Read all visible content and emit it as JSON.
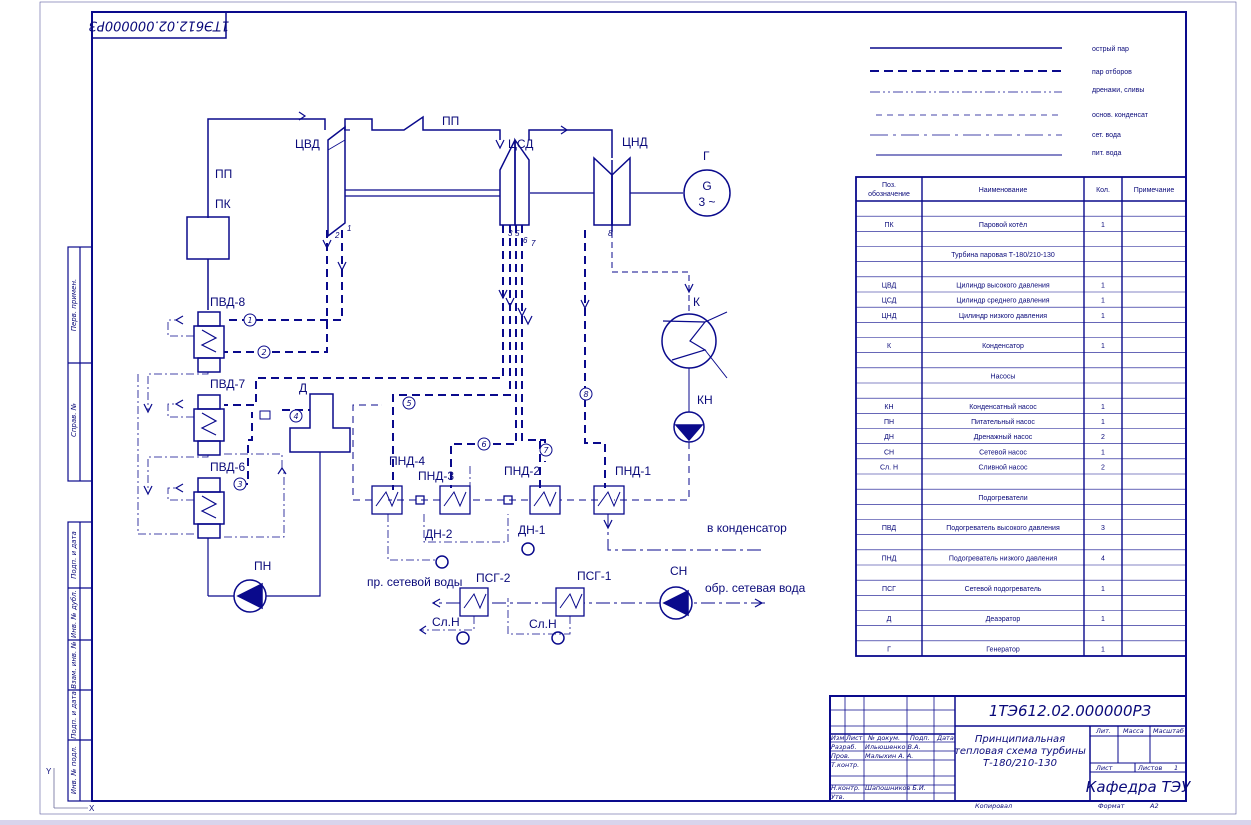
{
  "doc_code_rotated": "1ТЭ612.02.000000РЗ",
  "legend": [
    {
      "text": "острый пар"
    },
    {
      "text": "пар отборов"
    },
    {
      "text": "дренажи, сливы"
    },
    {
      "text": "основ. конденсат"
    },
    {
      "text": "сет. вода"
    },
    {
      "text": "пит. вода"
    }
  ],
  "equipment": {
    "pp1": "ПП",
    "pp2": "ПП",
    "pk": "ПК",
    "cvd": "ЦВД",
    "csd": "ЦСД",
    "cnd": "ЦНД",
    "g": "Г",
    "gen_g": "G",
    "gen_phase": "3 ~",
    "k": "К",
    "kn": "КН",
    "pvd8": "ПВД-8",
    "pvd7": "ПВД-7",
    "pvd6": "ПВД-6",
    "d": "Д",
    "pn": "ПН",
    "pnd4": "ПНД-4",
    "pnd3": "ПНД-3",
    "pnd2": "ПНД-2",
    "pnd1": "ПНД-1",
    "dn2": "ДН-2",
    "dn1": "ДН-1",
    "psg2": "ПСГ-2",
    "psg1": "ПСГ-1",
    "sln_a": "Сл.Н",
    "sln_b": "Сл.Н",
    "sn": "СН",
    "to_condenser": "в конденсатор",
    "pr_water": "пр. сетевой воды",
    "obr_water": "обр. сетевая вода"
  },
  "extraction_numbers": [
    "1",
    "2",
    "3",
    "4",
    "5",
    "6",
    "7",
    "8"
  ],
  "spec_table": {
    "headers": [
      "Поз. обозначение",
      "Наименование",
      "Кол.",
      "Примечание"
    ],
    "rows": [
      [
        "",
        "",
        "",
        ""
      ],
      [
        "ПК",
        "Паровой котёл",
        "1",
        ""
      ],
      [
        "",
        "",
        "",
        ""
      ],
      [
        "",
        "Турбина паровая Т-180/210-130",
        "",
        ""
      ],
      [
        "",
        "",
        "",
        ""
      ],
      [
        "ЦВД",
        "Цилиндр высокого давления",
        "1",
        ""
      ],
      [
        "ЦСД",
        "Цилиндр среднего давления",
        "1",
        ""
      ],
      [
        "ЦНД",
        "Цилиндр низкого давления",
        "1",
        ""
      ],
      [
        "",
        "",
        "",
        ""
      ],
      [
        "К",
        "Конденсатор",
        "1",
        ""
      ],
      [
        "",
        "",
        "",
        ""
      ],
      [
        "",
        "Насосы",
        "",
        ""
      ],
      [
        "",
        "",
        "",
        ""
      ],
      [
        "КН",
        "Конденсатный насос",
        "1",
        ""
      ],
      [
        "ПН",
        "Питательный насос",
        "1",
        ""
      ],
      [
        "ДН",
        "Дренажный насос",
        "2",
        ""
      ],
      [
        "СН",
        "Сетевой насос",
        "1",
        ""
      ],
      [
        "Сл. Н",
        "Сливной насос",
        "2",
        ""
      ],
      [
        "",
        "",
        "",
        ""
      ],
      [
        "",
        "Подогреватели",
        "",
        ""
      ],
      [
        "",
        "",
        "",
        ""
      ],
      [
        "ПВД",
        "Подогреватель высокого давления",
        "3",
        ""
      ],
      [
        "",
        "",
        "",
        ""
      ],
      [
        "ПНД",
        "Подогреватель низкого давления",
        "4",
        ""
      ],
      [
        "",
        "",
        "",
        ""
      ],
      [
        "ПСГ",
        "Сетевой подогреватель",
        "1",
        ""
      ],
      [
        "",
        "",
        "",
        ""
      ],
      [
        "Д",
        "Деаэратор",
        "1",
        ""
      ],
      [
        "",
        "",
        "",
        ""
      ],
      [
        "Г",
        "Генератор",
        "1",
        ""
      ]
    ]
  },
  "side_strip": [
    "Перв. примен.",
    "Справ. №",
    "Подп. и дата",
    "Инв. № дубл.",
    "Взам. инв. №",
    "Подп. и дата",
    "Инв. № подл."
  ],
  "title_block": {
    "code": "1ТЭ612.02.000000РЗ",
    "name_line1": "Принципиальная",
    "name_line2": "тепловая схема турбины",
    "name_line3": "Т-180/210-130",
    "col_izm": "Изм",
    "col_list": "Лист",
    "col_doc": "№ докум.",
    "col_podp": "Подп.",
    "col_data": "Дата",
    "razrab_label": "Разраб.",
    "razrab_name": "Ильюшенко В.А.",
    "prov_label": "Пров.",
    "prov_name": "Малыхин А. А.",
    "tkontr_label": "Т.контр.",
    "nkontr_label": "Н.контр.",
    "nkontr_name": "Шапошников Б.И.",
    "utv_label": "Утв.",
    "lit_label": "Лит.",
    "massa_label": "Масса",
    "masshtab_label": "Масштаб",
    "sheet_label": "Лист",
    "sheets_label": "Листов",
    "sheets_value": "1",
    "org": "Кафедра ТЭУ",
    "copied": "Копировал",
    "format_label": "Формат",
    "format_value": "А2"
  },
  "axis_x": "X",
  "axis_y": "Y"
}
